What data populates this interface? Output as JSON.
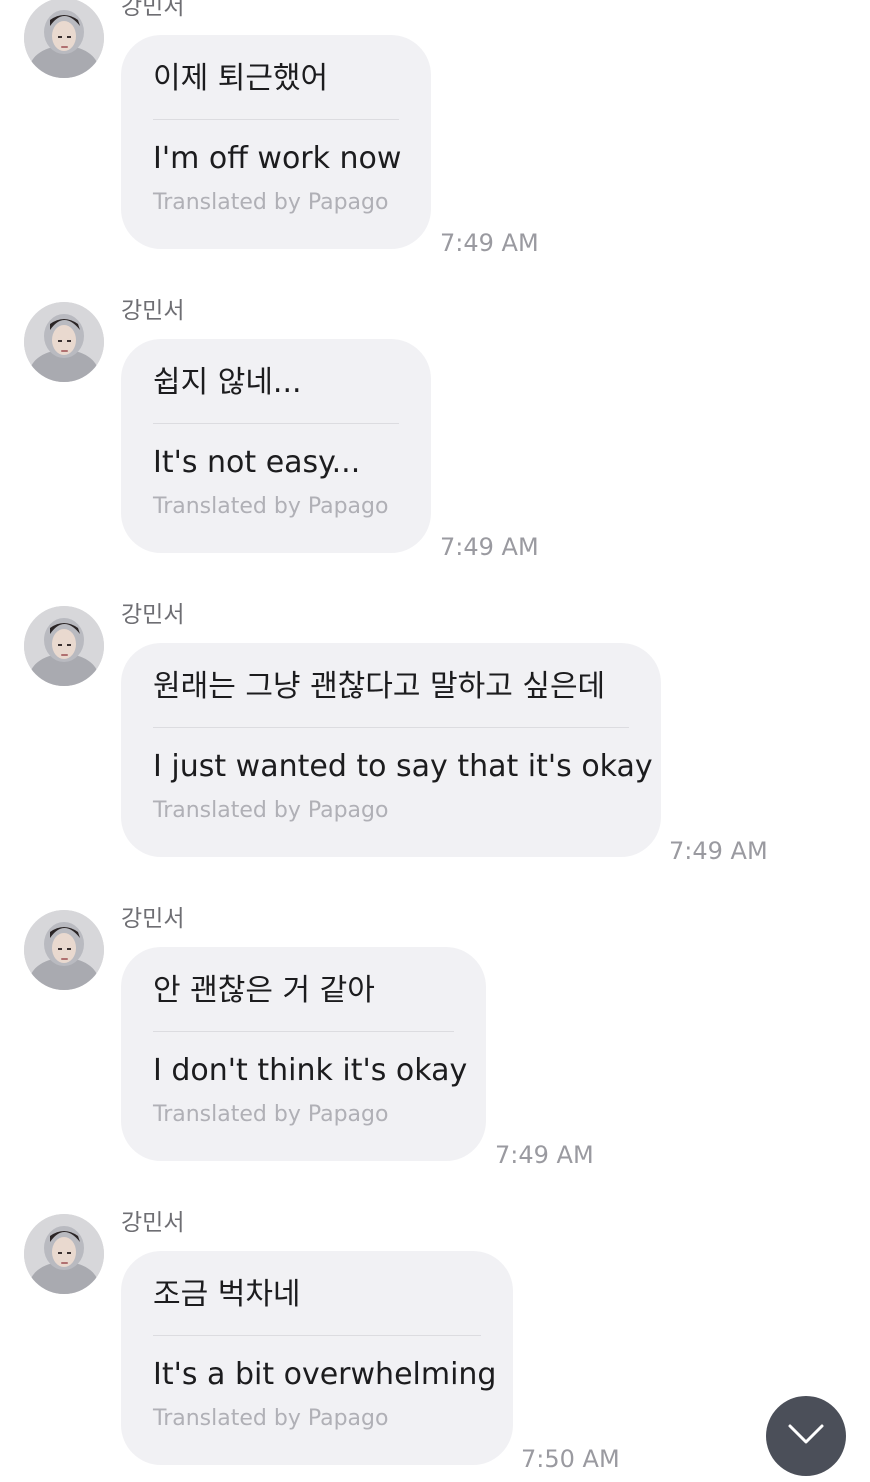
{
  "messages": [
    {
      "sender": "강민서",
      "original": "이제 퇴근했어",
      "translation": "I'm off work now",
      "credit": "Translated by Papago",
      "time": "7:49 AM"
    },
    {
      "sender": "강민서",
      "original": "쉽지 않네...",
      "translation": "It's not easy...",
      "credit": "Translated by Papago",
      "time": "7:49 AM"
    },
    {
      "sender": "강민서",
      "original": "원래는 그냥 괜찮다고 말하고 싶은데",
      "translation": "I just wanted to say that it's okay",
      "credit": "Translated by Papago",
      "time": "7:49 AM"
    },
    {
      "sender": "강민서",
      "original": "안 괜찮은 거 같아",
      "translation": "I don't think it's okay",
      "credit": "Translated by Papago",
      "time": "7:49 AM"
    },
    {
      "sender": "강민서",
      "original": "조금 벅차네",
      "translation": "It's a bit overwhelming",
      "credit": "Translated by Papago",
      "time": "7:50 AM"
    }
  ],
  "scroll_button": {
    "icon": "chevron-down-icon"
  },
  "colors": {
    "bubble": "#f1f1f4",
    "scroll_button": "#4b4f59"
  }
}
